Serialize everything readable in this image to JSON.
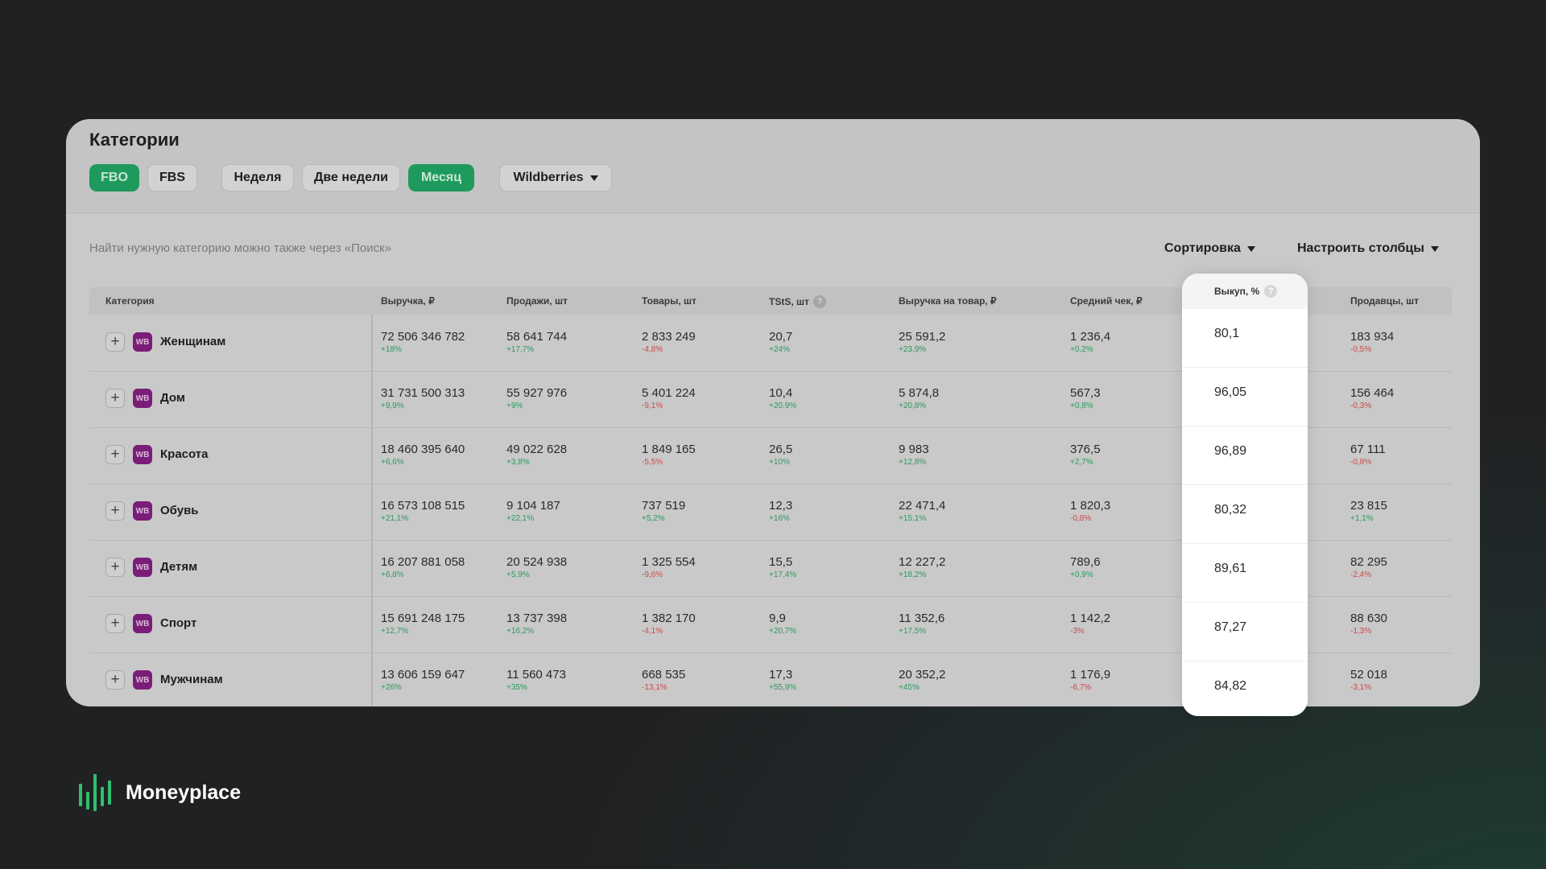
{
  "title": "Категории",
  "filters": {
    "fulfillment": [
      {
        "label": "FBO",
        "active": true
      },
      {
        "label": "FBS",
        "active": false
      }
    ],
    "period": [
      {
        "label": "Неделя",
        "active": false
      },
      {
        "label": "Две недели",
        "active": false
      },
      {
        "label": "Месяц",
        "active": true
      }
    ],
    "marketplace": "Wildberries"
  },
  "hint": "Найти нужную категорию можно также через «Поиск»",
  "actions": {
    "sort": "Сортировка",
    "columns": "Настроить столбцы"
  },
  "columns": {
    "category": "Категория",
    "revenue": "Выручка, ₽",
    "sales": "Продажи, шт",
    "goods": "Товары, шт",
    "tsts": "TStS, шт",
    "revenue_per_item": "Выручка на товар, ₽",
    "avg_check": "Средний чек, ₽",
    "buyout": "Выкуп, %",
    "sellers": "Продавцы, шт"
  },
  "help_icon": "?",
  "badge": "WB",
  "expand_symbol": "+",
  "rows": [
    {
      "name": "Женщинам",
      "revenue": "72 506 346 782",
      "revenue_d": "+18%",
      "sales": "58 641 744",
      "sales_d": "+17,7%",
      "goods": "2 833 249",
      "goods_d": "-4,8%",
      "tsts": "20,7",
      "tsts_d": "+24%",
      "rpi": "25 591,2",
      "rpi_d": "+23,9%",
      "check": "1 236,4",
      "check_d": "+0,2%",
      "buyout": "80,1",
      "sellers": "183 934",
      "sellers_d": "-0,5%"
    },
    {
      "name": "Дом",
      "revenue": "31 731 500 313",
      "revenue_d": "+9,9%",
      "sales": "55 927 976",
      "sales_d": "+9%",
      "goods": "5 401 224",
      "goods_d": "-9,1%",
      "tsts": "10,4",
      "tsts_d": "+20,9%",
      "rpi": "5 874,8",
      "rpi_d": "+20,8%",
      "check": "567,3",
      "check_d": "+0,8%",
      "buyout": "96,05",
      "sellers": "156 464",
      "sellers_d": "-0,3%"
    },
    {
      "name": "Красота",
      "revenue": "18 460 395 640",
      "revenue_d": "+6,6%",
      "sales": "49 022 628",
      "sales_d": "+3,8%",
      "goods": "1 849 165",
      "goods_d": "-5,5%",
      "tsts": "26,5",
      "tsts_d": "+10%",
      "rpi": "9 983",
      "rpi_d": "+12,8%",
      "check": "376,5",
      "check_d": "+2,7%",
      "buyout": "96,89",
      "sellers": "67 111",
      "sellers_d": "-0,8%"
    },
    {
      "name": "Обувь",
      "revenue": "16 573 108 515",
      "revenue_d": "+21,1%",
      "sales": "9 104 187",
      "sales_d": "+22,1%",
      "goods": "737 519",
      "goods_d": "+5,2%",
      "tsts": "12,3",
      "tsts_d": "+16%",
      "rpi": "22 471,4",
      "rpi_d": "+15,1%",
      "check": "1 820,3",
      "check_d": "-0,8%",
      "buyout": "80,32",
      "sellers": "23 815",
      "sellers_d": "+1,1%"
    },
    {
      "name": "Детям",
      "revenue": "16 207 881 058",
      "revenue_d": "+6,8%",
      "sales": "20 524 938",
      "sales_d": "+5,9%",
      "goods": "1 325 554",
      "goods_d": "-9,6%",
      "tsts": "15,5",
      "tsts_d": "+17,4%",
      "rpi": "12 227,2",
      "rpi_d": "+18,2%",
      "check": "789,6",
      "check_d": "+0,9%",
      "buyout": "89,61",
      "sellers": "82 295",
      "sellers_d": "-2,4%"
    },
    {
      "name": "Спорт",
      "revenue": "15 691 248 175",
      "revenue_d": "+12,7%",
      "sales": "13 737 398",
      "sales_d": "+16,2%",
      "goods": "1 382 170",
      "goods_d": "-4,1%",
      "tsts": "9,9",
      "tsts_d": "+20,7%",
      "rpi": "11 352,6",
      "rpi_d": "+17,5%",
      "check": "1 142,2",
      "check_d": "-3%",
      "buyout": "87,27",
      "sellers": "88 630",
      "sellers_d": "-1,3%"
    },
    {
      "name": "Мужчинам",
      "revenue": "13 606 159 647",
      "revenue_d": "+26%",
      "sales": "11 560 473",
      "sales_d": "+35%",
      "goods": "668 535",
      "goods_d": "-13,1%",
      "tsts": "17,3",
      "tsts_d": "+55,9%",
      "rpi": "20 352,2",
      "rpi_d": "+45%",
      "check": "1 176,9",
      "check_d": "-6,7%",
      "buyout": "84,82",
      "sellers": "52 018",
      "sellers_d": "-3,1%"
    }
  ],
  "brand": {
    "name": "Moneyplace",
    "logo_icon": "bars-logo-icon",
    "logo_color": "#2fbf6e"
  },
  "colors": {
    "accent": "#1f9a5d",
    "badge": "#7a1d78",
    "positive": "#2a9a5e",
    "negative": "#c94a4a"
  }
}
